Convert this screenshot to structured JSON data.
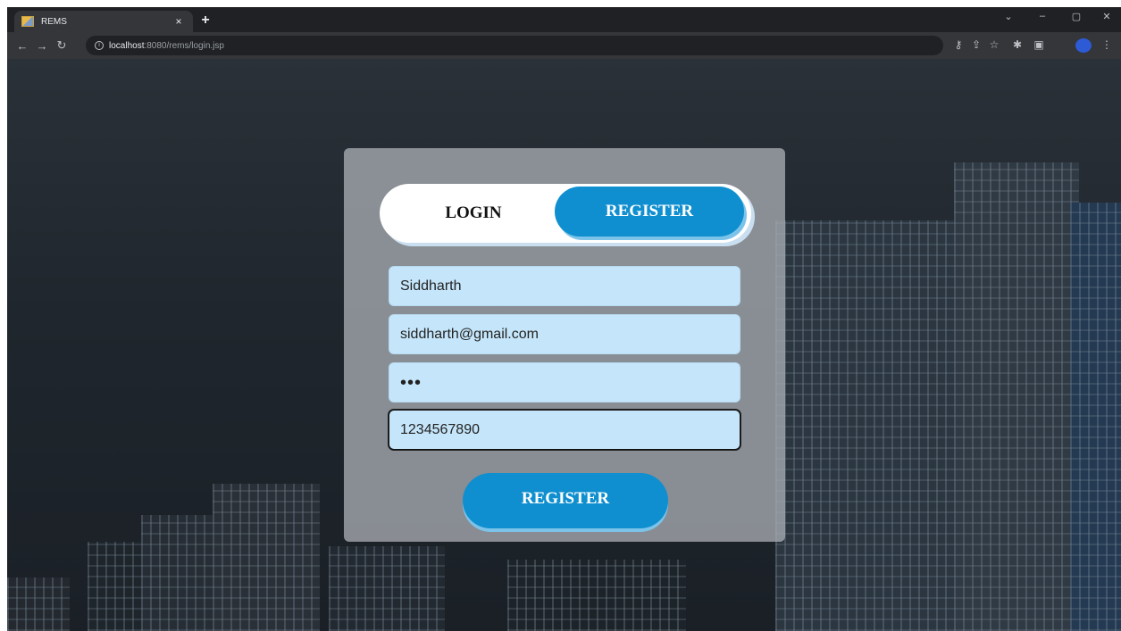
{
  "browser": {
    "tab_title": "REMS",
    "tab_close": "×",
    "new_tab": "+",
    "url_host": "localhost",
    "url_path": ":8080/rems/login.jsp",
    "window_controls": [
      "⌄",
      "–",
      "▢",
      "✕"
    ]
  },
  "form": {
    "tabs": {
      "login": "LOGIN",
      "register": "REGISTER"
    },
    "fields": {
      "name": "Siddharth",
      "email": "siddharth@gmail.com",
      "password_mask": "•••",
      "phone": "1234567890"
    },
    "submit_label": "REGISTER"
  },
  "colors": {
    "accent": "#0f8fcf",
    "input_bg": "#c5e6fa"
  }
}
